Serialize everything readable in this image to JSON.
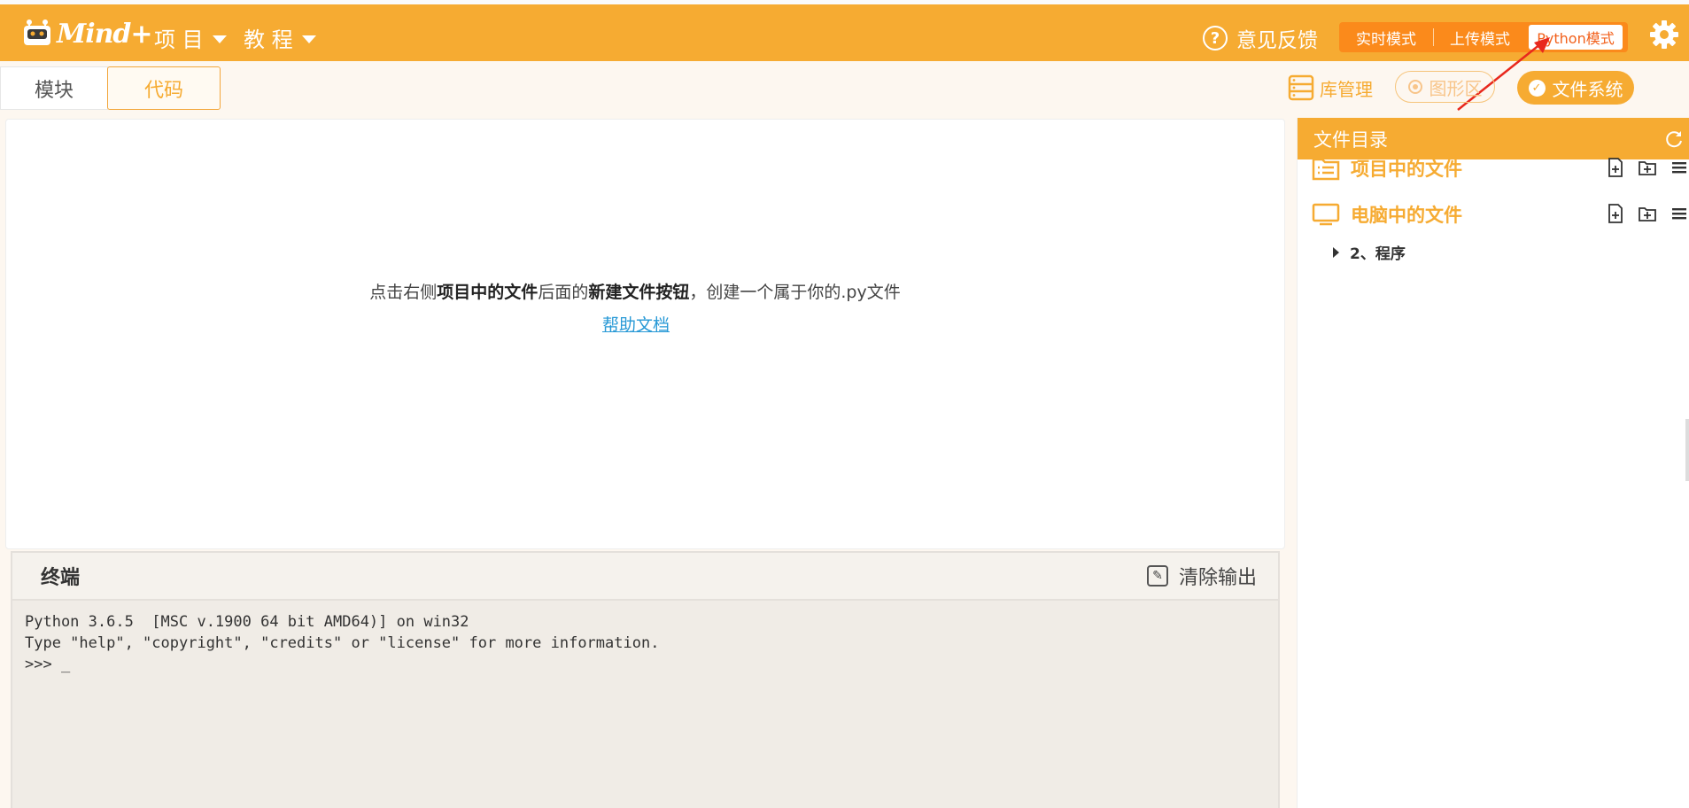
{
  "header": {
    "logo_text": "Mind+",
    "menu_project": "项 目",
    "menu_tutorial": "教 程",
    "feedback": "意见反馈",
    "modes": {
      "realtime": "实时模式",
      "upload": "上传模式",
      "python": "Python模式"
    }
  },
  "tabs": {
    "blocks": "模块",
    "code": "代码"
  },
  "toolbar": {
    "library": "库管理",
    "graphics": "图形区",
    "filesystem": "文件系统"
  },
  "editor": {
    "hint_prefix": "点击右侧",
    "hint_bold1": "项目中的文件",
    "hint_middle": "后面的",
    "hint_bold2": "新建文件按钮",
    "hint_suffix": "，创建一个属于你的.py文件",
    "help_link": "帮助文档"
  },
  "terminal": {
    "title": "终端",
    "clear": "清除输出",
    "lines": "Python 3.6.5  [MSC v.1900 64 bit AMD64)] on win32\nType \"help\", \"copyright\", \"credits\" or \"license\" for more information.\n>>> _"
  },
  "filepanel": {
    "title": "文件目录",
    "project_files": "项目中的文件",
    "computer_files": "电脑中的文件",
    "tree_item": "2、程序"
  },
  "colors": {
    "brand": "#f6ab32",
    "mode_bg": "#fb8a1b",
    "active_mode_text": "#f2611c",
    "link": "#2899d6"
  }
}
